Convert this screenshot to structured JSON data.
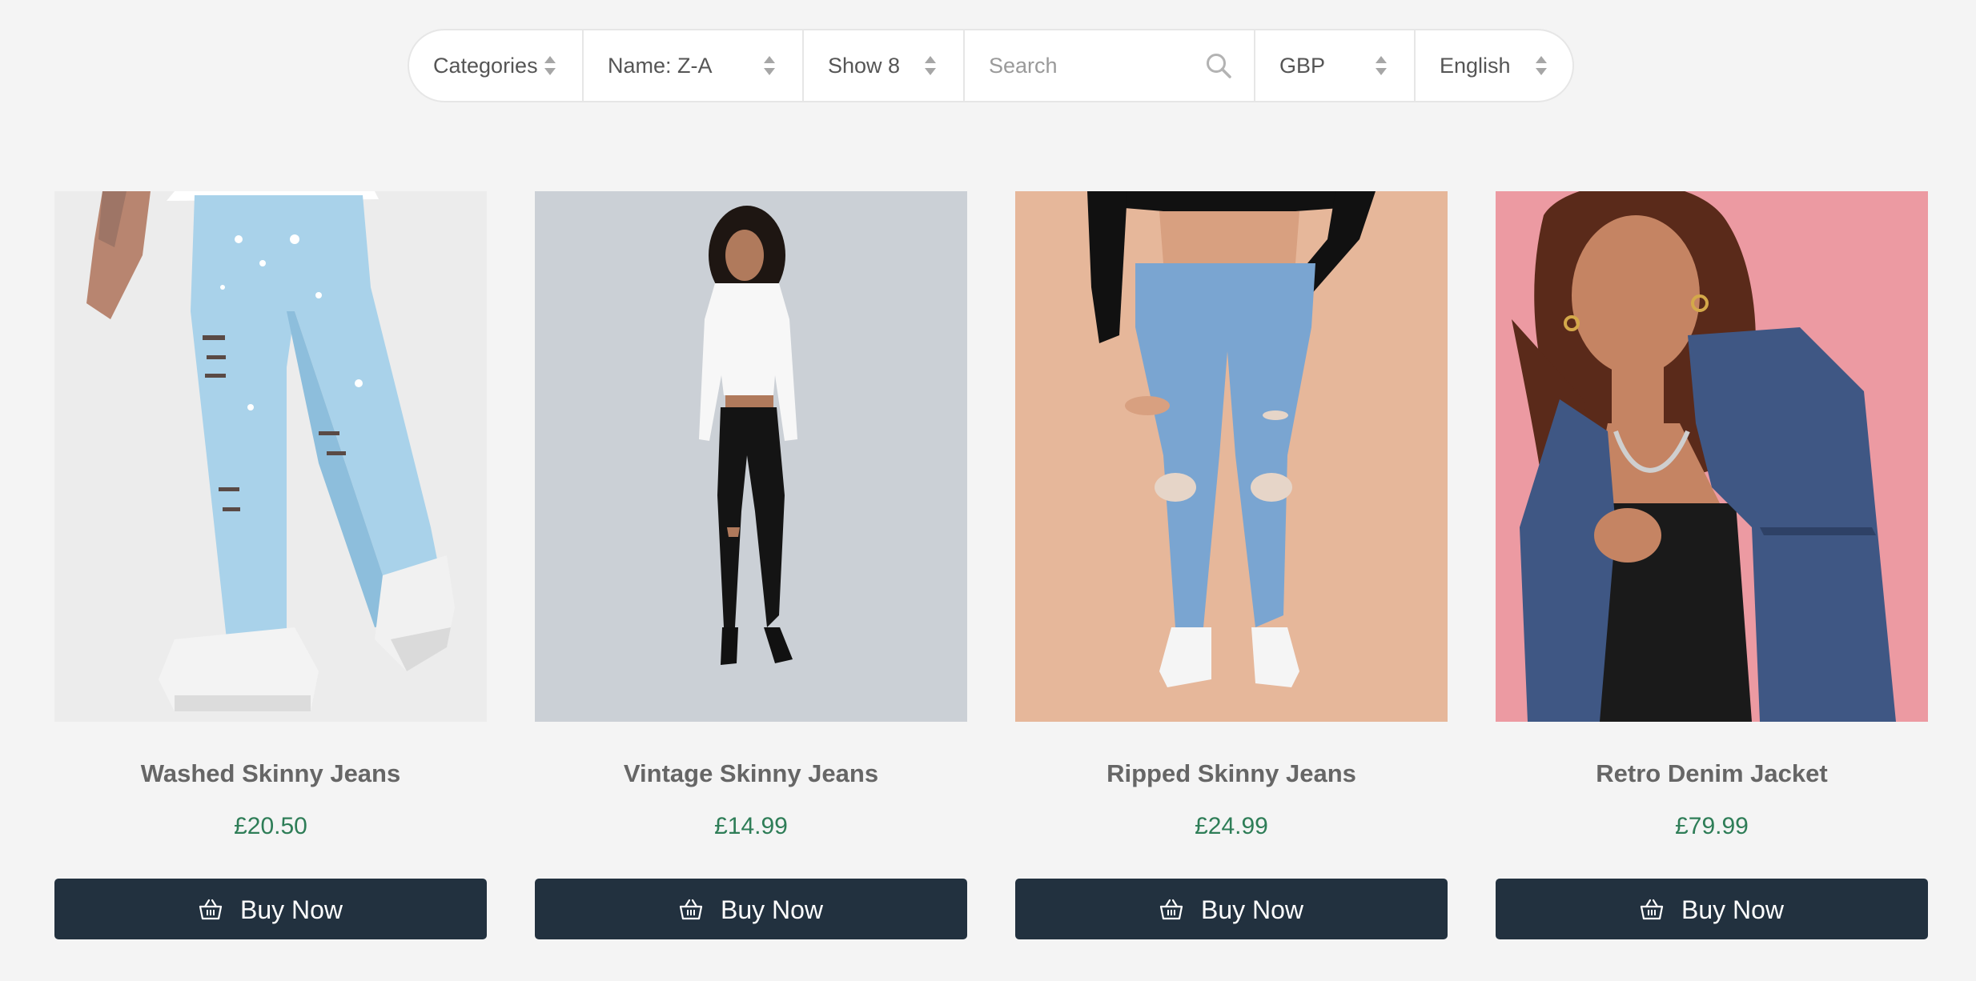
{
  "filters": {
    "categories": "Categories",
    "sort": "Name: Z-A",
    "show": "Show 8",
    "search_placeholder": "Search",
    "currency": "GBP",
    "language": "English"
  },
  "products": [
    {
      "name": "Washed Skinny Jeans",
      "price": "£20.50",
      "button": "Buy Now",
      "image": "light blue ripped skinny jeans with white sneakers"
    },
    {
      "name": "Vintage Skinny Jeans",
      "price": "£14.99",
      "button": "Buy Now",
      "image": "model in white crop top and black skinny jeans"
    },
    {
      "name": "Ripped Skinny Jeans",
      "price": "£24.99",
      "button": "Buy Now",
      "image": "blue ripped skinny jeans with black crop top"
    },
    {
      "name": "Retro Denim Jacket",
      "price": "£79.99",
      "button": "Buy Now",
      "image": "model wearing sleeveless denim jacket on pink background"
    }
  ],
  "colors": {
    "background": "#f4f4f4",
    "button": "#22313f",
    "price": "#2e7d57",
    "title": "#666666"
  }
}
